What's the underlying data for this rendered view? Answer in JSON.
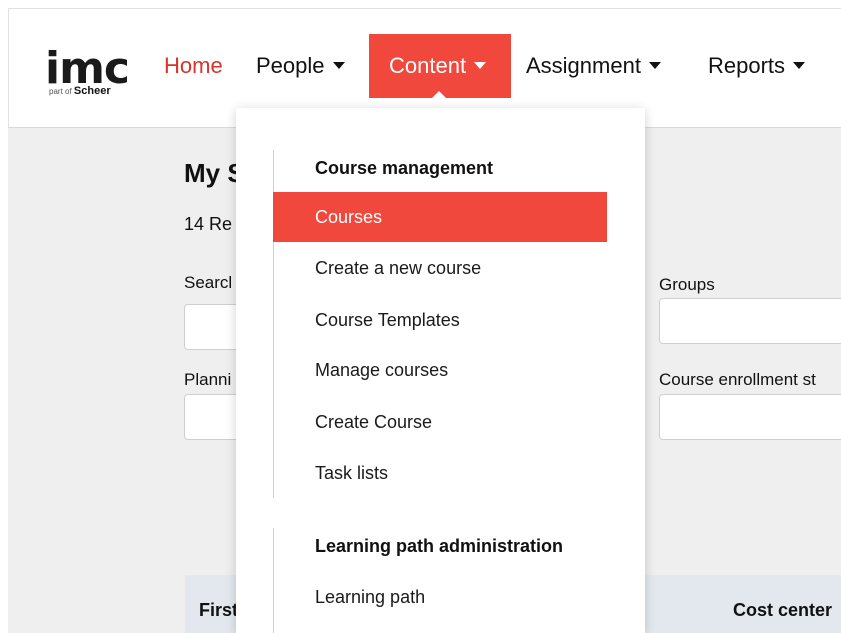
{
  "logo": {
    "brand": "imc",
    "sub_prefix": "part of",
    "sub_name": "Scheer"
  },
  "nav": {
    "home": "Home",
    "people": "People",
    "content": "Content",
    "assignment": "Assignment",
    "reports": "Reports"
  },
  "main": {
    "title": "My S",
    "count": "14 Re",
    "fields": {
      "search_label": "Searcl",
      "groups_label": "Groups",
      "planning_label": "Planni",
      "enrollment_label": "Course enrollment st"
    },
    "table": {
      "col_first": "First",
      "col_cost_center": "Cost center"
    }
  },
  "dropdown": {
    "sections": [
      {
        "heading": "Course management",
        "items": [
          "Courses",
          "Create a new course",
          "Course Templates",
          "Manage courses",
          "Create Course",
          "Task lists"
        ]
      },
      {
        "heading": "Learning path administration",
        "items": [
          "Learning path"
        ]
      }
    ],
    "selected": "Courses"
  },
  "colors": {
    "accent": "#f0483d",
    "home": "#d8342b",
    "table_header": "#e3e8ee"
  },
  "icons": {
    "caret": "chevron-down-icon"
  }
}
